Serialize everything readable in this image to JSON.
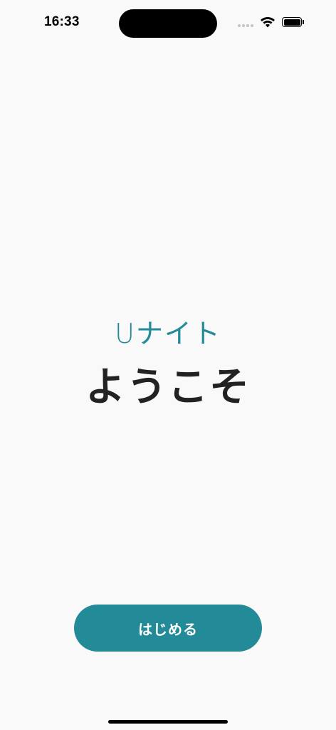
{
  "status_bar": {
    "time": "16:33"
  },
  "main": {
    "logo_text": "Uナイト",
    "welcome_text": "ようこそ",
    "start_button_label": "はじめる"
  },
  "colors": {
    "accent": "#238b98",
    "background": "#f9f9f9",
    "heading": "#222222"
  },
  "icons": [
    "wifi-icon",
    "battery-icon",
    "cellular-signal-icon"
  ]
}
